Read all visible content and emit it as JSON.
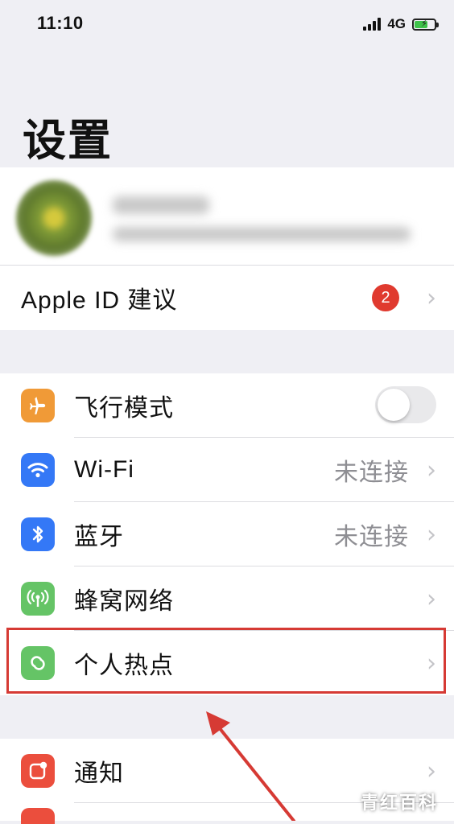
{
  "status_bar": {
    "time": "11:10",
    "network": "4G"
  },
  "page": {
    "title": "设置"
  },
  "apple_id": {
    "suggestion_label": "Apple ID 建议",
    "badge_count": "2"
  },
  "settings": {
    "airplane": {
      "label": "飞行模式",
      "toggle_on": false,
      "icon": "airplane-icon",
      "color": "#f09a37"
    },
    "wifi": {
      "label": "Wi-Fi",
      "value": "未连接",
      "icon": "wifi-icon",
      "color": "#3478f6"
    },
    "bluetooth": {
      "label": "蓝牙",
      "value": "未连接",
      "icon": "bluetooth-icon",
      "color": "#3478f6"
    },
    "cellular": {
      "label": "蜂窝网络",
      "icon": "cellular-antenna-icon",
      "color": "#65c466"
    },
    "hotspot": {
      "label": "个人热点",
      "icon": "hotspot-icon",
      "color": "#65c466"
    },
    "notifications": {
      "label": "通知",
      "icon": "notifications-icon",
      "color": "#eb4e3d"
    }
  },
  "annotation": {
    "highlight_color": "#d63a34"
  },
  "watermark": {
    "text": "青红百科"
  }
}
